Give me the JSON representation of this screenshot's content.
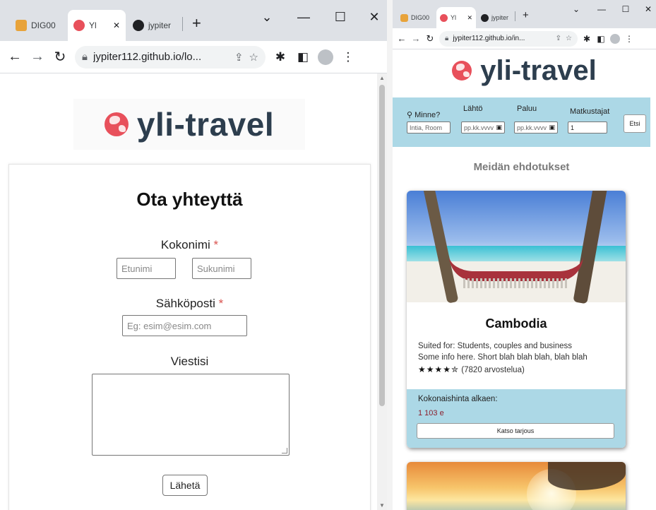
{
  "left": {
    "tabs": [
      {
        "label": "DIG00"
      },
      {
        "label": "Yl",
        "close": "✕"
      },
      {
        "label": "jypiter"
      }
    ],
    "new_tab": "+",
    "window": {
      "dropdown": "⌄",
      "minimize": "—",
      "maximize": "☐",
      "close": "✕"
    },
    "url": "jypiter112.github.io/lo...",
    "logo_text": "yli-travel",
    "form": {
      "title": "Ota yhteyttä",
      "fullname_label": "Kokonimi",
      "required_mark": "*",
      "firstname_placeholder": "Etunimi",
      "lastname_placeholder": "Sukunimi",
      "email_label": "Sähköposti",
      "email_placeholder": "Eg: esim@esim.com",
      "message_label": "Viestisi",
      "submit_label": "Lähetä"
    }
  },
  "right": {
    "tabs": [
      {
        "label": "DIG00"
      },
      {
        "label": "Yl",
        "close": "✕"
      },
      {
        "label": "jypiter"
      }
    ],
    "new_tab": "+",
    "window": {
      "dropdown": "⌄",
      "minimize": "—",
      "maximize": "☐",
      "close": "✕"
    },
    "url": "jypiter112.github.io/in...",
    "logo_text": "yli-travel",
    "search": {
      "where_label": "Minne?",
      "where_placeholder": "Intia, Room",
      "depart_label": "Lähtö",
      "depart_placeholder": "pp.kk.vvvv",
      "return_label": "Paluu",
      "return_placeholder": "pp.kk.vvvv",
      "travelers_label": "Matkustajat",
      "travelers_value": "1",
      "search_button": "Etsi"
    },
    "suggestions_title": "Meidän ehdotukset",
    "offer": {
      "title": "Cambodia",
      "suited_for": "Suited for: Students, couples and business",
      "info": "Some info here. Short blah blah blah, blah blah",
      "stars": "★★★★✮",
      "rating_value": 4.5,
      "reviews": "(7820 arvostelua)",
      "price_label": "Kokonaishinta alkaen:",
      "price": "1 103 e",
      "button": "Katso tarjous"
    }
  },
  "colors": {
    "brand_red": "#e8505b",
    "logo_text": "#2d3e4e",
    "search_bg": "#acd8e6",
    "price_text": "#8b1e2c",
    "required": "#d9534f"
  },
  "icons": [
    "back-icon",
    "forward-icon",
    "reload-icon",
    "lock-icon",
    "share-icon",
    "star-icon",
    "extensions-icon",
    "sidepanel-icon",
    "profile-icon",
    "menu-icon",
    "search-icon",
    "calendar-icon"
  ]
}
